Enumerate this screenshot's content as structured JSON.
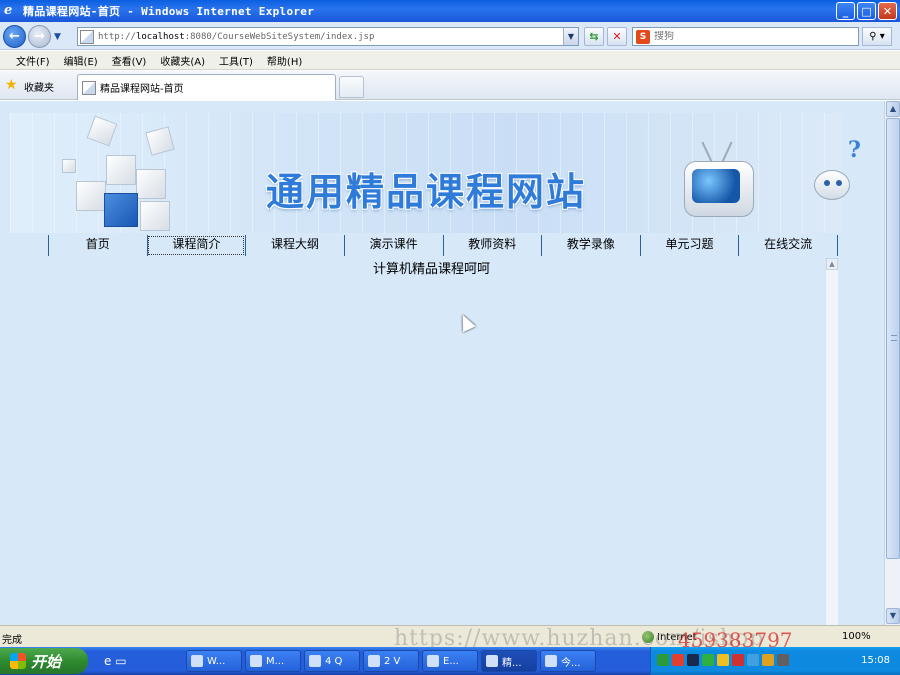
{
  "window": {
    "title": "精品课程网站-首页 - Windows Internet Explorer",
    "minimize": "_",
    "maximize": "□",
    "close": "✕"
  },
  "address": {
    "url_prefix": "http://",
    "url_host": "localhost",
    "url_rest": ":8080/CourseWebSiteSystem/index.jsp"
  },
  "search": {
    "placeholder": "搜狗",
    "logo": "S"
  },
  "menu": [
    "文件(F)",
    "编辑(E)",
    "查看(V)",
    "收藏夹(A)",
    "工具(T)",
    "帮助(H)"
  ],
  "favorites": {
    "label": "收藏夹",
    "tab_title": "精品课程网站-首页"
  },
  "page": {
    "banner_title": "通用精品课程网站",
    "nav": [
      "首页",
      "课程简介",
      "课程大纲",
      "演示课件",
      "教师资料",
      "教学录像",
      "单元习题",
      "在线交流"
    ],
    "active_nav_index": 1,
    "course_text": "计算机精品课程呵呵"
  },
  "status": {
    "text": "完成",
    "zone": "Internet",
    "zoom": "100%"
  },
  "watermark": {
    "url": "https://www.huzhan.com/ishop",
    "number": "459383797"
  },
  "taskbar": {
    "start": "开始",
    "tasks": [
      "W...",
      "M...",
      "4 Q",
      "2 V",
      "E...",
      "精...",
      "今..."
    ],
    "active_task_index": 5,
    "clock": "15:08"
  },
  "colors": {
    "page_bg": "#d7e8f8",
    "banner_title": "#2f7bd9",
    "nav_divider": "#2a5f9e"
  }
}
